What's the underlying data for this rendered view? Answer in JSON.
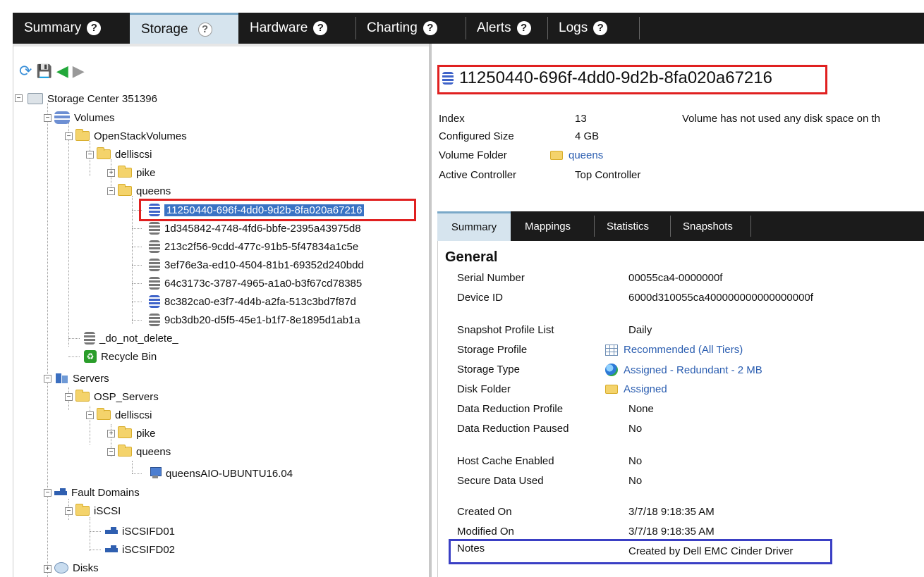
{
  "top_tabs": [
    {
      "label": "Summary",
      "active": false
    },
    {
      "label": "Storage",
      "active": true
    },
    {
      "label": "Hardware",
      "active": false
    },
    {
      "label": "Charting",
      "active": false
    },
    {
      "label": "Alerts",
      "active": false
    },
    {
      "label": "Logs",
      "active": false
    }
  ],
  "help_glyph": "?",
  "toolbar": {
    "refresh": "⟳",
    "save": "💾",
    "back": "◀",
    "forward": "▶"
  },
  "tree": {
    "root": "Storage Center 351396",
    "volumes": "Volumes",
    "openstack_volumes": "OpenStackVolumes",
    "delliscsi": "delliscsi",
    "pike": "pike",
    "queens": "queens",
    "volume_items": [
      {
        "label": "11250440-696f-4dd0-9d2b-8fa020a67216",
        "selected": true,
        "icon": "volume-blue"
      },
      {
        "label": "1d345842-4748-4fd6-bbfe-2395a43975d8",
        "selected": false,
        "icon": "volume-gray"
      },
      {
        "label": "213c2f56-9cdd-477c-91b5-5f47834a1c5e",
        "selected": false,
        "icon": "volume-gray"
      },
      {
        "label": "3ef76e3a-ed10-4504-81b1-69352d240bdd",
        "selected": false,
        "icon": "volume-gray"
      },
      {
        "label": "64c3173c-3787-4965-a1a0-b3f67cd78385",
        "selected": false,
        "icon": "volume-gray"
      },
      {
        "label": "8c382ca0-e3f7-4d4b-a2fa-513c3bd7f87d",
        "selected": false,
        "icon": "volume-blue"
      },
      {
        "label": "9cb3db20-d5f5-45e1-b1f7-8e1895d1ab1a",
        "selected": false,
        "icon": "volume-gray"
      }
    ],
    "do_not_delete": "_do_not_delete_",
    "recycle_bin": "Recycle Bin",
    "servers": "Servers",
    "osp_servers": "OSP_Servers",
    "server_delliscsi": "delliscsi",
    "server_pike": "pike",
    "server_queens": "queens",
    "server_host": "queensAIO-UBUNTU16.04",
    "fault_domains": "Fault Domains",
    "iscsi": "iSCSI",
    "iscsifd01": "iSCSIFD01",
    "iscsifd02": "iSCSIFD02",
    "disks": "Disks"
  },
  "volume": {
    "title": "11250440-696f-4dd0-9d2b-8fa020a67216",
    "index_label": "Index",
    "index_value": "13",
    "size_label": "Configured Size",
    "size_value": "4 GB",
    "folder_label": "Volume Folder",
    "folder_value": "queens",
    "controller_label": "Active Controller",
    "controller_value": "Top Controller",
    "disk_notice": "Volume has not used any disk space on th"
  },
  "sub_tabs": [
    "Summary",
    "Mappings",
    "Statistics",
    "Snapshots"
  ],
  "general": {
    "title": "General",
    "rows": [
      {
        "label": "Serial Number",
        "value": "00055ca4-0000000f"
      },
      {
        "label": "Device ID",
        "value": "6000d310055ca400000000000000000f"
      },
      {
        "label": "Snapshot Profile List",
        "value": "Daily"
      },
      {
        "label": "Storage Profile",
        "value": "Recommended (All Tiers)"
      },
      {
        "label": "Storage Type",
        "value": "Assigned - Redundant - 2 MB"
      },
      {
        "label": "Disk Folder",
        "value": "Assigned"
      },
      {
        "label": "Data Reduction Profile",
        "value": "None"
      },
      {
        "label": "Data Reduction Paused",
        "value": "No"
      },
      {
        "label": "Host Cache Enabled",
        "value": "No"
      },
      {
        "label": "Secure Data Used",
        "value": "No"
      },
      {
        "label": "Created On",
        "value": "3/7/18 9:18:35 AM"
      },
      {
        "label": "Modified On",
        "value": "3/7/18 9:18:35 AM"
      },
      {
        "label": "Notes",
        "value": "Created by Dell EMC Cinder Driver"
      }
    ]
  },
  "colors": {
    "tab_bar": "#1b1b1b",
    "active_tab": "#d6e4ee",
    "selection": "#3a73c4",
    "highlight_red": "#e02020",
    "highlight_blue": "#3a3fc4",
    "link": "#2a5db0"
  }
}
